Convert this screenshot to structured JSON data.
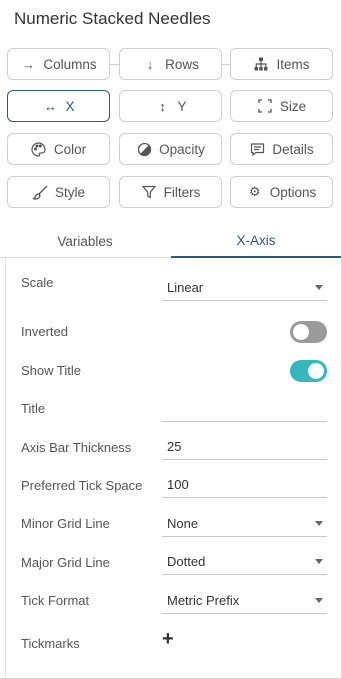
{
  "panel_title": "Numeric Stacked Needles",
  "buttons": {
    "columns": "Columns",
    "rows": "Rows",
    "items": "Items",
    "x": "X",
    "y": "Y",
    "size": "Size",
    "color": "Color",
    "opacity": "Opacity",
    "details": "Details",
    "style": "Style",
    "filters": "Filters",
    "options": "Options"
  },
  "tabs": {
    "variables": "Variables",
    "x_axis": "X-Axis",
    "active": "X-Axis"
  },
  "settings": {
    "scale_label": "Scale",
    "scale_value": "Linear",
    "inverted_label": "Inverted",
    "inverted_on": false,
    "show_title_label": "Show Title",
    "show_title_on": true,
    "title_label": "Title",
    "title_value": "",
    "axis_bar_thickness_label": "Axis Bar Thickness",
    "axis_bar_thickness_value": "25",
    "preferred_tick_space_label": "Preferred Tick Space",
    "preferred_tick_space_value": "100",
    "minor_grid_line_label": "Minor Grid Line",
    "minor_grid_line_value": "None",
    "major_grid_line_label": "Major Grid Line",
    "major_grid_line_value": "Dotted",
    "tick_format_label": "Tick Format",
    "tick_format_value": "Metric Prefix",
    "tickmarks_label": "Tickmarks"
  },
  "colors": {
    "accent": "#2a5d7c",
    "toggle_on": "#34b8bd",
    "toggle_off": "#9a9a9a"
  }
}
